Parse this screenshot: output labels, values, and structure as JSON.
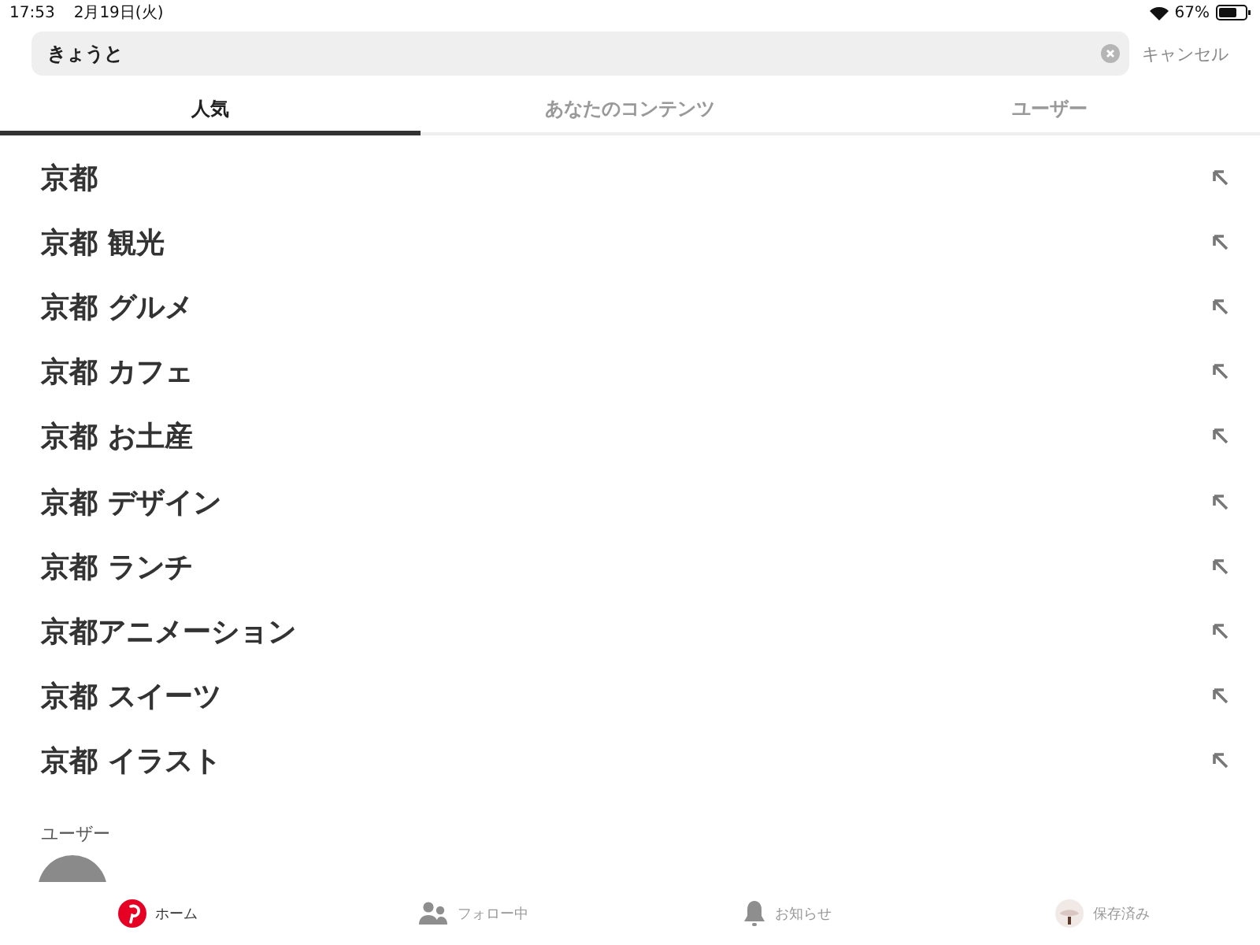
{
  "status_bar": {
    "time": "17:53",
    "date": "2月19日(火)",
    "battery": "67%"
  },
  "search": {
    "value": "きょうと",
    "cancel": "キャンセル"
  },
  "tabs": [
    {
      "label": "人気",
      "selected": true
    },
    {
      "label": "あなたのコンテンツ",
      "selected": false
    },
    {
      "label": "ユーザー",
      "selected": false
    }
  ],
  "suggestions": [
    "京都",
    "京都 観光",
    "京都 グルメ",
    "京都 カフェ",
    "京都 お土産",
    "京都 デザイン",
    "京都 ランチ",
    "京都アニメーション",
    "京都 スイーツ",
    "京都 イラスト"
  ],
  "users_section": {
    "title": "ユーザー"
  },
  "nav": [
    {
      "kind": "home",
      "label": "ホーム",
      "selected": true
    },
    {
      "kind": "following",
      "label": "フォロー中",
      "selected": false
    },
    {
      "kind": "notifications",
      "label": "お知らせ",
      "selected": false
    },
    {
      "kind": "saved",
      "label": "保存済み",
      "selected": false
    }
  ]
}
